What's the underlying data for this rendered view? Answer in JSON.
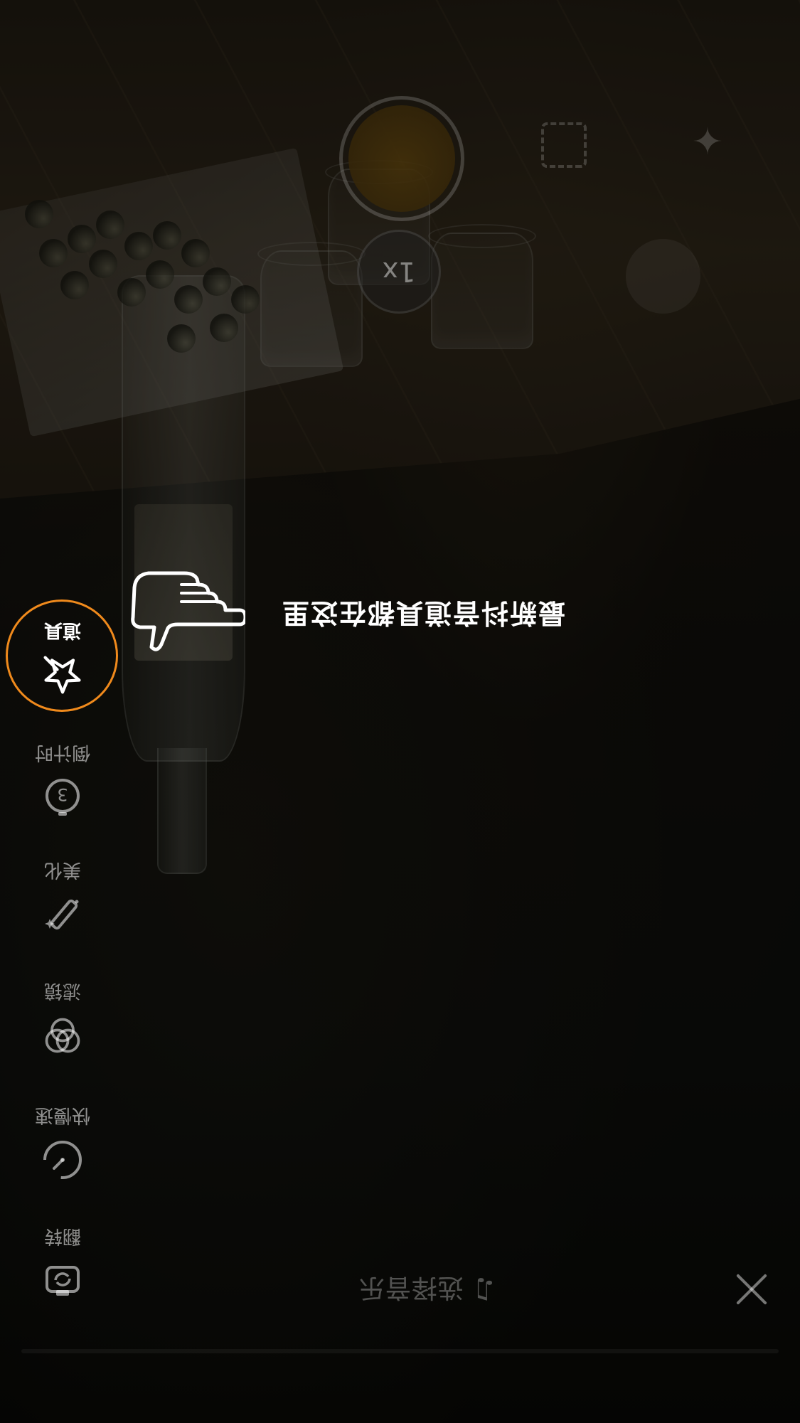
{
  "top_bar": {
    "music_label": "选择音乐",
    "music_icon": "music-note-icon",
    "close_icon": "close-icon"
  },
  "side_menu": {
    "items": [
      {
        "key": "flip",
        "label": "翻转",
        "icon": "camera-flip-icon"
      },
      {
        "key": "speed",
        "label": "快慢速",
        "icon": "speed-dial-icon"
      },
      {
        "key": "filter",
        "label": "滤镜",
        "icon": "filter-circles-icon"
      },
      {
        "key": "beauty",
        "label": "美化",
        "icon": "magic-wand-icon"
      },
      {
        "key": "countdown",
        "label": "倒计时",
        "icon": "countdown-timer-icon"
      },
      {
        "key": "props",
        "label": "道具",
        "icon": "star-wand-icon"
      }
    ],
    "active_item": "props"
  },
  "tooltip": {
    "text": "最新抖音道具都在这里",
    "hand_icon": "pointing-hand-icon"
  },
  "camera": {
    "zoom_label": "1x",
    "shutter_icon": "record-button",
    "frame_icon": "frame-icon",
    "sparkle_icon": "sparkle-icon"
  },
  "colors": {
    "highlight": "#f08a1c",
    "label": "#ffffff"
  }
}
